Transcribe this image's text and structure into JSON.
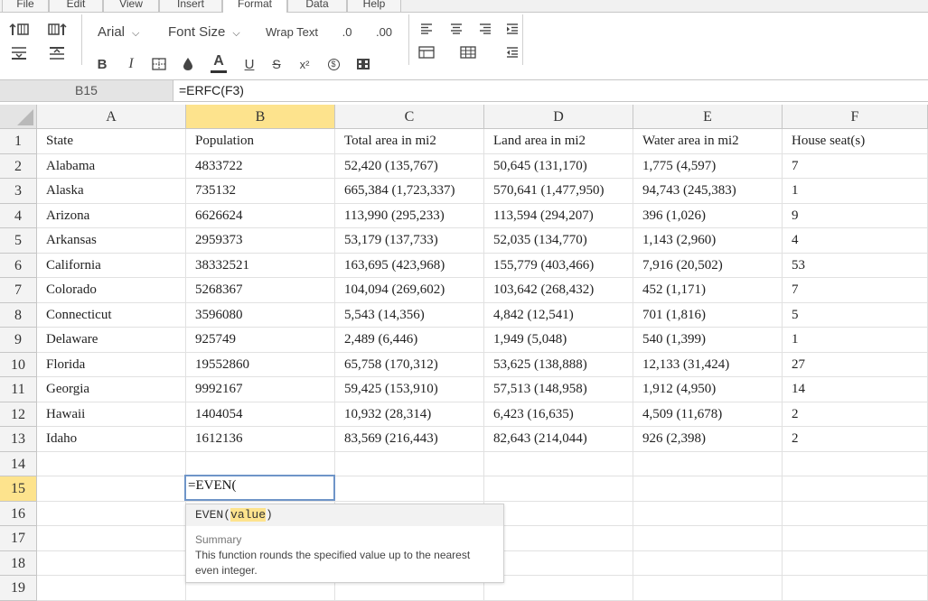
{
  "menu": {
    "tabs": [
      {
        "label": "File"
      },
      {
        "label": "Edit"
      },
      {
        "label": "View"
      },
      {
        "label": "Insert"
      },
      {
        "label": "Format",
        "active": true
      },
      {
        "label": "Data"
      },
      {
        "label": "Help"
      }
    ]
  },
  "toolbar": {
    "font_family": "Arial",
    "font_size": "Font Size",
    "wrap_text": "Wrap Text",
    "decrease_decimal": ".0",
    "increase_decimal": ".00",
    "bold": "B",
    "italic": "I",
    "font_color": "A",
    "underline": "U",
    "strikethrough": "S",
    "superscript": "x²",
    "currency": "$"
  },
  "formula_bar": {
    "cell_ref": "B15",
    "formula": "=ERFC(F3)"
  },
  "sheet": {
    "columns": [
      "A",
      "B",
      "C",
      "D",
      "E",
      "F"
    ],
    "active_column": "B",
    "active_row": 15,
    "row_numbers": [
      "1",
      "2",
      "3",
      "4",
      "5",
      "6",
      "7",
      "8",
      "9",
      "10",
      "11",
      "12",
      "13",
      "14",
      "15",
      "16",
      "17",
      "18",
      "19"
    ],
    "rows": [
      [
        "State",
        "Population",
        "Total area in mi2",
        "Land area in mi2",
        "Water area in mi2",
        "House seat(s)"
      ],
      [
        "Alabama",
        "4833722",
        "52,420 (135,767)",
        "50,645 (131,170)",
        "1,775 (4,597)",
        "7"
      ],
      [
        "Alaska",
        "735132",
        "665,384 (1,723,337)",
        "570,641 (1,477,950)",
        "94,743 (245,383)",
        "1"
      ],
      [
        "Arizona",
        "6626624",
        "113,990 (295,233)",
        "113,594 (294,207)",
        "396 (1,026)",
        "9"
      ],
      [
        "Arkansas",
        "2959373",
        "53,179 (137,733)",
        "52,035 (134,770)",
        "1,143 (2,960)",
        "4"
      ],
      [
        "California",
        "38332521",
        "163,695 (423,968)",
        "155,779 (403,466)",
        "7,916 (20,502)",
        "53"
      ],
      [
        "Colorado",
        "5268367",
        "104,094 (269,602)",
        "103,642 (268,432)",
        "452 (1,171)",
        "7"
      ],
      [
        "Connecticut",
        "3596080",
        "5,543 (14,356)",
        "4,842 (12,541)",
        "701 (1,816)",
        "5"
      ],
      [
        "Delaware",
        "925749",
        "2,489 (6,446)",
        "1,949 (5,048)",
        "540 (1,399)",
        "1"
      ],
      [
        "Florida",
        "19552860",
        "65,758 (170,312)",
        "53,625 (138,888)",
        "12,133 (31,424)",
        "27"
      ],
      [
        "Georgia",
        "9992167",
        "59,425 (153,910)",
        "57,513 (148,958)",
        "1,912 (4,950)",
        "14"
      ],
      [
        "Hawaii",
        "1404054",
        "10,932 (28,314)",
        "6,423 (16,635)",
        "4,509 (11,678)",
        "2"
      ],
      [
        "Idaho",
        "1612136",
        "83,569 (216,443)",
        "82,643 (214,044)",
        "926 (2,398)",
        "2"
      ]
    ]
  },
  "editor": {
    "value": "=EVEN("
  },
  "autocomplete": {
    "function_name": "EVEN(",
    "argument": "value",
    "close": ")",
    "summary_label": "Summary",
    "description": "This function rounds the specified value up to the nearest even integer."
  },
  "colors": {
    "active_header": "#fde38d",
    "editor_border": "#6f95c8",
    "header_bg": "#f3f3f3"
  }
}
